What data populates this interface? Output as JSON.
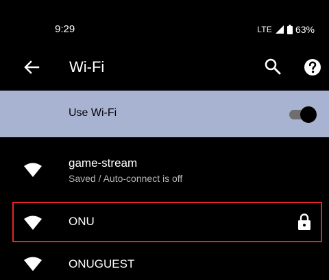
{
  "status_bar": {
    "time": "9:29",
    "network_type": "LTE",
    "battery": "63%",
    "icons": [
      "signal-icon",
      "battery-icon"
    ]
  },
  "app_bar": {
    "title": "Wi-Fi",
    "icons": [
      "back-arrow-icon",
      "search-icon",
      "help-icon"
    ]
  },
  "use_wifi": {
    "label": "Use Wi-Fi",
    "enabled": true
  },
  "networks": [
    {
      "name": "game-stream",
      "status": "Saved / Auto-connect is off",
      "icon": "wifi-signal-icon",
      "secured": false
    },
    {
      "name": "ONU",
      "icon": "wifi-signal-icon",
      "secured": true,
      "secured_icon": "lock-icon",
      "highlighted": true
    },
    {
      "name": "ONUGUEST",
      "icon": "wifi-signal-icon",
      "secured": false
    }
  ],
  "colors": {
    "background": "#000000",
    "use_wifi_row": "#a8b3d1",
    "highlight_border": "#e8232b",
    "secondary_text": "#b5b5b5"
  }
}
